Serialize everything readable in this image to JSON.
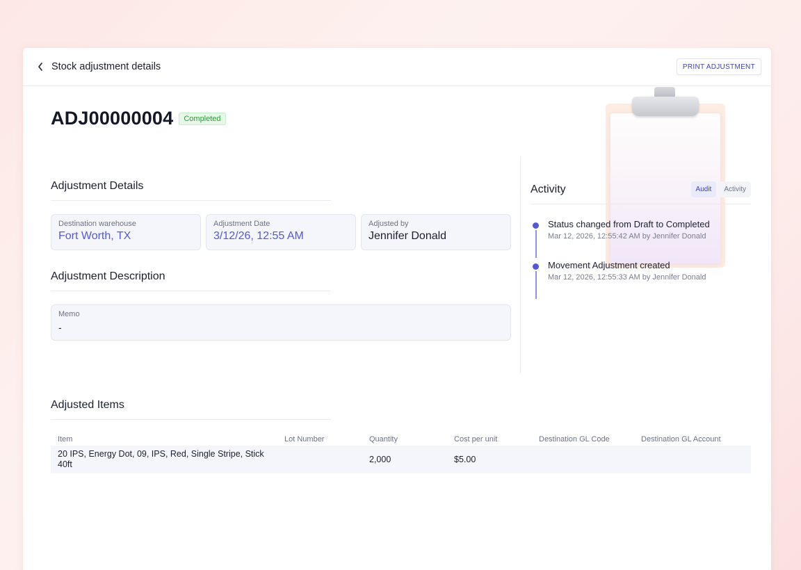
{
  "header": {
    "title": "Stock adjustment details",
    "print_label": "PRINT ADJUSTMENT"
  },
  "adjustment": {
    "id": "ADJ00000004",
    "status": "Completed"
  },
  "details": {
    "section_title": "Adjustment Details",
    "fields": [
      {
        "label": "Destination warehouse",
        "value": "Fort Worth, TX"
      },
      {
        "label": "Adjustment Date",
        "value": "3/12/26, 12:55 AM"
      },
      {
        "label": "Adjusted by",
        "value": "Jennifer Donald"
      }
    ]
  },
  "description": {
    "section_title": "Adjustment Description",
    "memo_label": "Memo",
    "memo_value": "-"
  },
  "activity": {
    "title": "Activity",
    "tabs": [
      "Audit",
      "Activity"
    ],
    "active_tab": "Audit",
    "events": [
      {
        "text": "Status changed from Draft to Completed",
        "meta": "Mar 12, 2026, 12:55:42 AM by Jennifer Donald"
      },
      {
        "text": "Movement Adjustment created",
        "meta": "Mar 12, 2026, 12:55:33 AM by Jennifer Donald"
      }
    ]
  },
  "items": {
    "section_title": "Adjusted Items",
    "columns": [
      "Item",
      "Lot Number",
      "Quantity",
      "Cost per unit",
      "Destination GL Code",
      "Destination GL Account"
    ],
    "rows": [
      {
        "item_line1": "20 IPS, Energy Dot, 09, IPS, Red, Single Stripe, Stick",
        "item_line2": "40ft",
        "lot": "",
        "quantity": "2,000",
        "cost": "$5.00",
        "gl_code": "",
        "gl_account": ""
      }
    ]
  },
  "colors": {
    "accent": "#5458d6",
    "status_green": "#2f9a3e",
    "background_pink": "#fde8e6"
  },
  "icons": {
    "back": "chevron-left-icon",
    "illustration": "clipboard-illustration"
  }
}
